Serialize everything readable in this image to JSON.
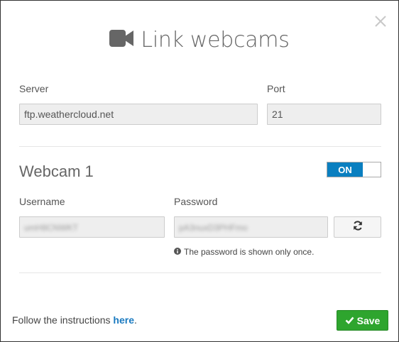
{
  "dialog": {
    "title": "Link webcams",
    "title_icon": "video-camera-icon",
    "close_icon": "close-icon"
  },
  "server": {
    "label": "Server",
    "value": "ftp.weathercloud.net"
  },
  "port": {
    "label": "Port",
    "value": "21"
  },
  "webcam": {
    "title": "Webcam 1",
    "toggle_label": "ON",
    "username": {
      "label": "Username",
      "value": "umH8CNWKT"
    },
    "password": {
      "label": "Password",
      "value": "pA3nuxD3PHFmo"
    },
    "refresh_icon": "refresh-icon",
    "note": "The password is shown only once."
  },
  "footer": {
    "text_prefix": "Follow the instructions ",
    "link_text": "here",
    "text_suffix": ".",
    "save_label": "Save"
  },
  "colors": {
    "toggle_on": "#0a7fc0",
    "save_button": "#2ea52e",
    "link": "#1a7ac0"
  }
}
